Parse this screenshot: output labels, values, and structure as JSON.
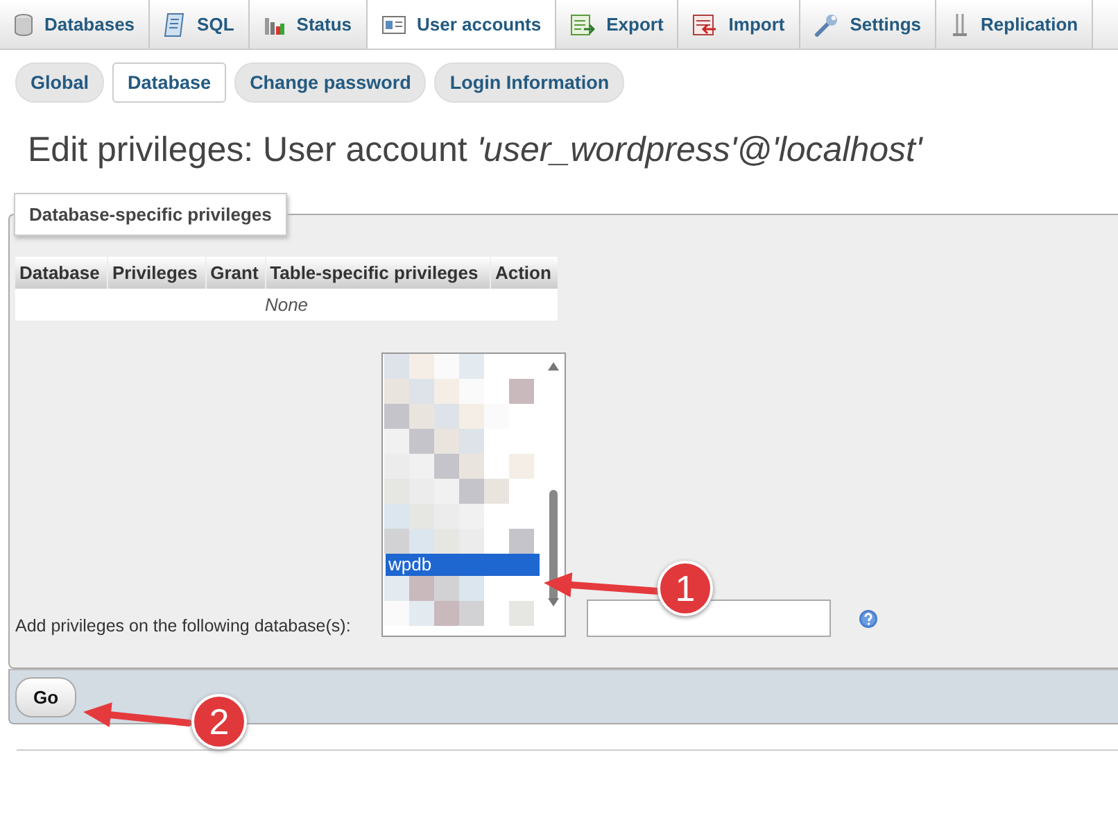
{
  "tabs": [
    {
      "label": "Databases",
      "kind": "database",
      "selected": false
    },
    {
      "label": "SQL",
      "kind": "sql",
      "selected": false
    },
    {
      "label": "Status",
      "kind": "status",
      "selected": false
    },
    {
      "label": "User accounts",
      "kind": "users",
      "selected": true
    },
    {
      "label": "Export",
      "kind": "export",
      "selected": false
    },
    {
      "label": "Import",
      "kind": "import",
      "selected": false
    },
    {
      "label": "Settings",
      "kind": "settings",
      "selected": false
    },
    {
      "label": "Replication",
      "kind": "replication",
      "selected": false
    }
  ],
  "subtabs": [
    {
      "label": "Global",
      "selected": false
    },
    {
      "label": "Database",
      "selected": true
    },
    {
      "label": "Change password",
      "selected": false
    },
    {
      "label": "Login Information",
      "selected": false
    }
  ],
  "heading": {
    "prefix": "Edit privileges: User account ",
    "account": "'user_wordpress'@'localhost'"
  },
  "fieldset": {
    "legend": "Database-specific privileges",
    "table": {
      "columns": [
        "Database",
        "Privileges",
        "Grant",
        "Table-specific privileges",
        "Action"
      ],
      "empty_text": "None"
    },
    "add_label": "Add privileges on the following database(s):",
    "listbox": {
      "items": [
        {
          "label": "wpdb",
          "selected": true
        }
      ]
    },
    "go_button": "Go"
  },
  "annotations": [
    {
      "label": "1"
    },
    {
      "label": "2"
    }
  ]
}
